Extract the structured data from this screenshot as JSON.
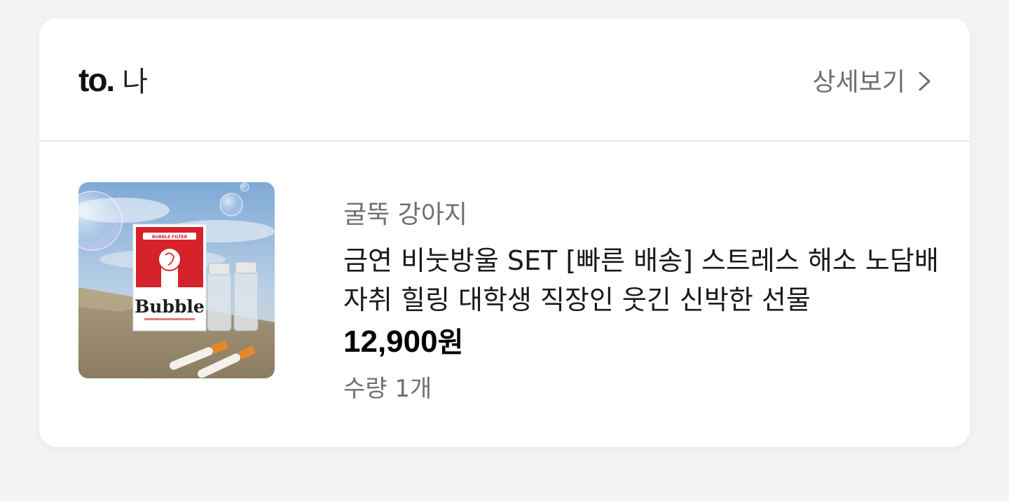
{
  "recipient": {
    "prefix": "to.",
    "name": "나"
  },
  "header": {
    "detail_label": "상세보기",
    "detail_icon": "chevron-right-icon"
  },
  "item": {
    "image_icon": "product-thumbnail",
    "image_brand_text": "Bubble",
    "image_box_label": "BUBBLE FILTER",
    "seller": "굴뚝 강아지",
    "title": "금연 비눗방울 SET [빠른 배송] 스트레스 해소 노담배 자취 힐링 대학생 직장인 웃긴 신박한 선물",
    "price_number": "12,900",
    "price_unit": "원",
    "quantity": "수량 1개"
  },
  "colors": {
    "page_bg": "#f4f4f4",
    "card_bg": "#ffffff",
    "muted_text": "#707070",
    "box_red": "#d6222a"
  }
}
